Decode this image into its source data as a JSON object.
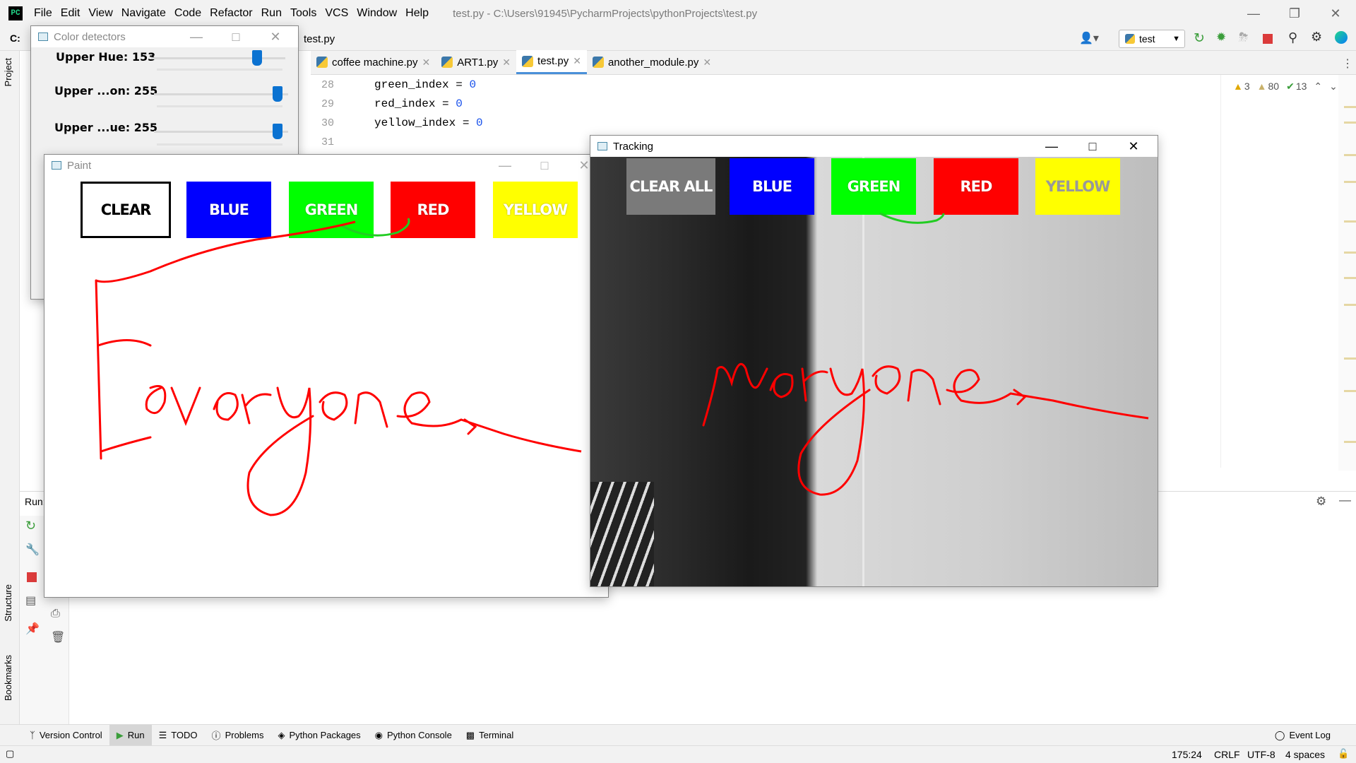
{
  "ide": {
    "menu": [
      "File",
      "Edit",
      "View",
      "Navigate",
      "Code",
      "Refactor",
      "Run",
      "Tools",
      "VCS",
      "Window",
      "Help"
    ],
    "title_path": "test.py - C:\\Users\\91945\\PycharmProjects\\pythonProjects\\test.py",
    "breadcrumb_root": "C:",
    "breadcrumb_file": "test.py",
    "run_config": "test",
    "tabs": [
      {
        "label": "coffee machine.py",
        "active": false
      },
      {
        "label": "ART1.py",
        "active": false
      },
      {
        "label": "test.py",
        "active": true
      },
      {
        "label": "another_module.py",
        "active": false
      }
    ],
    "code_lines": [
      {
        "num": "28",
        "name": "green_index",
        "op": " = ",
        "val": "0"
      },
      {
        "num": "29",
        "name": "red_index",
        "op": " = ",
        "val": "0"
      },
      {
        "num": "30",
        "name": "yellow_index",
        "op": " = ",
        "val": "0"
      },
      {
        "num": "31",
        "name": "",
        "op": "",
        "val": ""
      }
    ],
    "inspections": {
      "warnings": "3",
      "weak_warnings": "80",
      "typos": "13"
    },
    "left_tools": {
      "project": "Project",
      "structure": "Structure",
      "bookmarks": "Bookmarks"
    },
    "run_label": "Run:",
    "bottom_tabs": [
      "Version Control",
      "Run",
      "TODO",
      "Problems",
      "Python Packages",
      "Python Console",
      "Terminal"
    ],
    "event_log": "Event Log",
    "status": {
      "position": "175:24",
      "line_sep": "CRLF",
      "encoding": "UTF-8",
      "indent": "4 spaces"
    }
  },
  "color_detectors": {
    "title": "Color detectors",
    "sliders": [
      {
        "label": "Upper Hue: 153",
        "value": 153,
        "max": 180
      },
      {
        "label": "Upper ...on: 255",
        "value": 255,
        "max": 255
      },
      {
        "label": "Upper ...ue: 255",
        "value": 255,
        "max": 255
      }
    ]
  },
  "paint": {
    "title": "Paint",
    "buttons": [
      "CLEAR",
      "BLUE",
      "GREEN",
      "RED",
      "YELLOW"
    ],
    "colors": {
      "clear": "#ffffff",
      "blue": "#0000ff",
      "green": "#00ff00",
      "red": "#ff0000",
      "yellow": "#ffff00"
    }
  },
  "tracking": {
    "title": "Tracking",
    "buttons": [
      "CLEAR ALL",
      "BLUE",
      "GREEN",
      "RED",
      "YELLOW"
    ],
    "colors": {
      "clear_all": "#7a7a7a",
      "blue": "#0000ff",
      "green": "#00ff00",
      "red": "#ff0000",
      "yellow": "#ffff00"
    }
  },
  "stroke_color": "#ff0000"
}
